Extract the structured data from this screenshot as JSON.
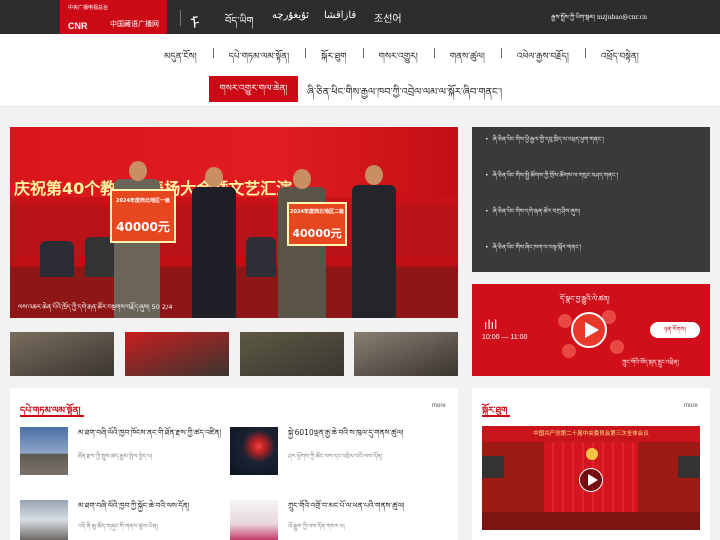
{
  "header": {
    "logo_line1": "中央广播电视总台",
    "logo_cnr": "CNR",
    "logo_line2": "中国藏语广播网",
    "mongol_glyph": "ᠮ",
    "languages": [
      "བོད་ཡིག",
      "ئۇيغۇرچە",
      "قازاقشا",
      "조선어"
    ],
    "contact_label": "རྒྱས་སྤྲོས་ཀྱི་ཡིག་སྒམ།",
    "contact_email": "mzjubao@cnr.cn"
  },
  "nav": {
    "items": [
      "མདུན་ངོས།",
      "དཔེ་གཏམ་ལམ་སྟོན།",
      "སྐོར་ཐུག",
      "གསར་འགྱུར།",
      "གནས་ཚུལ།",
      "འཕེལ་རྒྱས་བརྗོད།",
      "འཕྲོད་བསྟེན།"
    ],
    "feature_label": "གསར་འགྱུར་གལ་ཆེན།",
    "marquee": "ཞི་ཅིན་ཕིང་གིས་རྒྱལ་ཁབ་ཀྱི་འབྲེལ་ལམ་ལ་སྐོར་ཞིབ་གནང་།"
  },
  "hero": {
    "banner_text": "庆祝第40个教师节表扬大会暨文艺汇演",
    "sign1_line1": "2024年度西北地区一级",
    "sign1_amount": "40000元",
    "sign2_line1": "2024年度西北地区二级",
    "sign2_amount": "40000元",
    "caption": "ལས་འཆར་ཆེན་པོའི་ཁྲོད་ཀྱི་དགེ་རྒན་ཚོར་བསྔགས་བརྗོད་ཞུས།",
    "caption_count": "50",
    "caption_page": "2/4"
  },
  "thumb_colors": [
    "#7a6d5e",
    "#c81e1e",
    "#5c5a44",
    "#8a7e72"
  ],
  "sidebar_news": [
    "ཞི་ཅིན་ཕིང་གིས་ཕྱི་རྒྱལ་གྱི་དབུ་ཁྲིད་ལ་འཕྲད་ཕྱག་གནང་།",
    "ཞི་ཅིན་ཕིང་གིས་སྤྱི་ཚོགས་ཀྱི་གྲོས་ཚོགས་ལ་གསུང་བཤད་གནང་།",
    "ཞི་ཅིན་ཕིང་གིས་དགེ་རྒན་ཚོར་བཀྲ་ཤིས་ཞུས།",
    "ཞི་ཅིན་ཕིང་གིས་ཞིང་ཁག་ལ་བལྟ་སྐོར་གནང་།"
  ],
  "radio": {
    "title": "དོ་སྣང་བྱ་རྒྱུའི་ལེ་ཚན།",
    "time": "10:00 — 11:00",
    "button": "ཉན་རོགས།",
    "subtitle": "ཀྲུང་གོའི་བོད་སྐད་རླུང་འཕྲིན།"
  },
  "left_panel": {
    "title": "དཔེ་གཏམ་ལམ་སྟོན།",
    "more": "more",
    "cards": [
      {
        "title": "མ་ཐག་བཞི་ལོའི་ཁྱབ་ཁོངས་ནང་གི་ཐོན་རྫས་ཀྱི་ཚད་འཛིན།",
        "summary": "ཐོན་རྫས་ཀྱི་སྤུས་ཚད་རྒྱས་སྤེལ་བྱེད་པ།"
      },
      {
        "title": "སྐྱེ་6010ལྡན་རྒྱ་ཆེ་བའི་ས་ཁུལ་དུ་གནས་ཚུལ།",
        "summary": "ཤར་ཕྱོགས་ཀྱི་ཚོང་ལས་དང་འབྲེལ་བའི་ལས་དོན།"
      },
      {
        "title": "མ་ཐག་བཞི་ལོའི་ཁྱབ་ཀྱི་སྐྱོང་ཆེ་བའི་ལས་དོན།",
        "summary": "འདི་ནི་ཆུ་ཚོད་གཞུང་གི་གནས་ཚུལ་ཡིན།"
      },
      {
        "title": "ཀྲུང་གོའི་འགྲོ་བ་མང་པོ་ལ་ཕན་པའི་གནས་ཚུལ།",
        "summary": "ལོ་རྒྱུས་ཀྱི་ལས་དོན་གསར་པ།"
      }
    ]
  },
  "right_panel": {
    "title": "སྐོར་ཐུག",
    "more": "more",
    "meeting_banner": "中国共产党第二十届中央委员会第三次全体会议"
  }
}
